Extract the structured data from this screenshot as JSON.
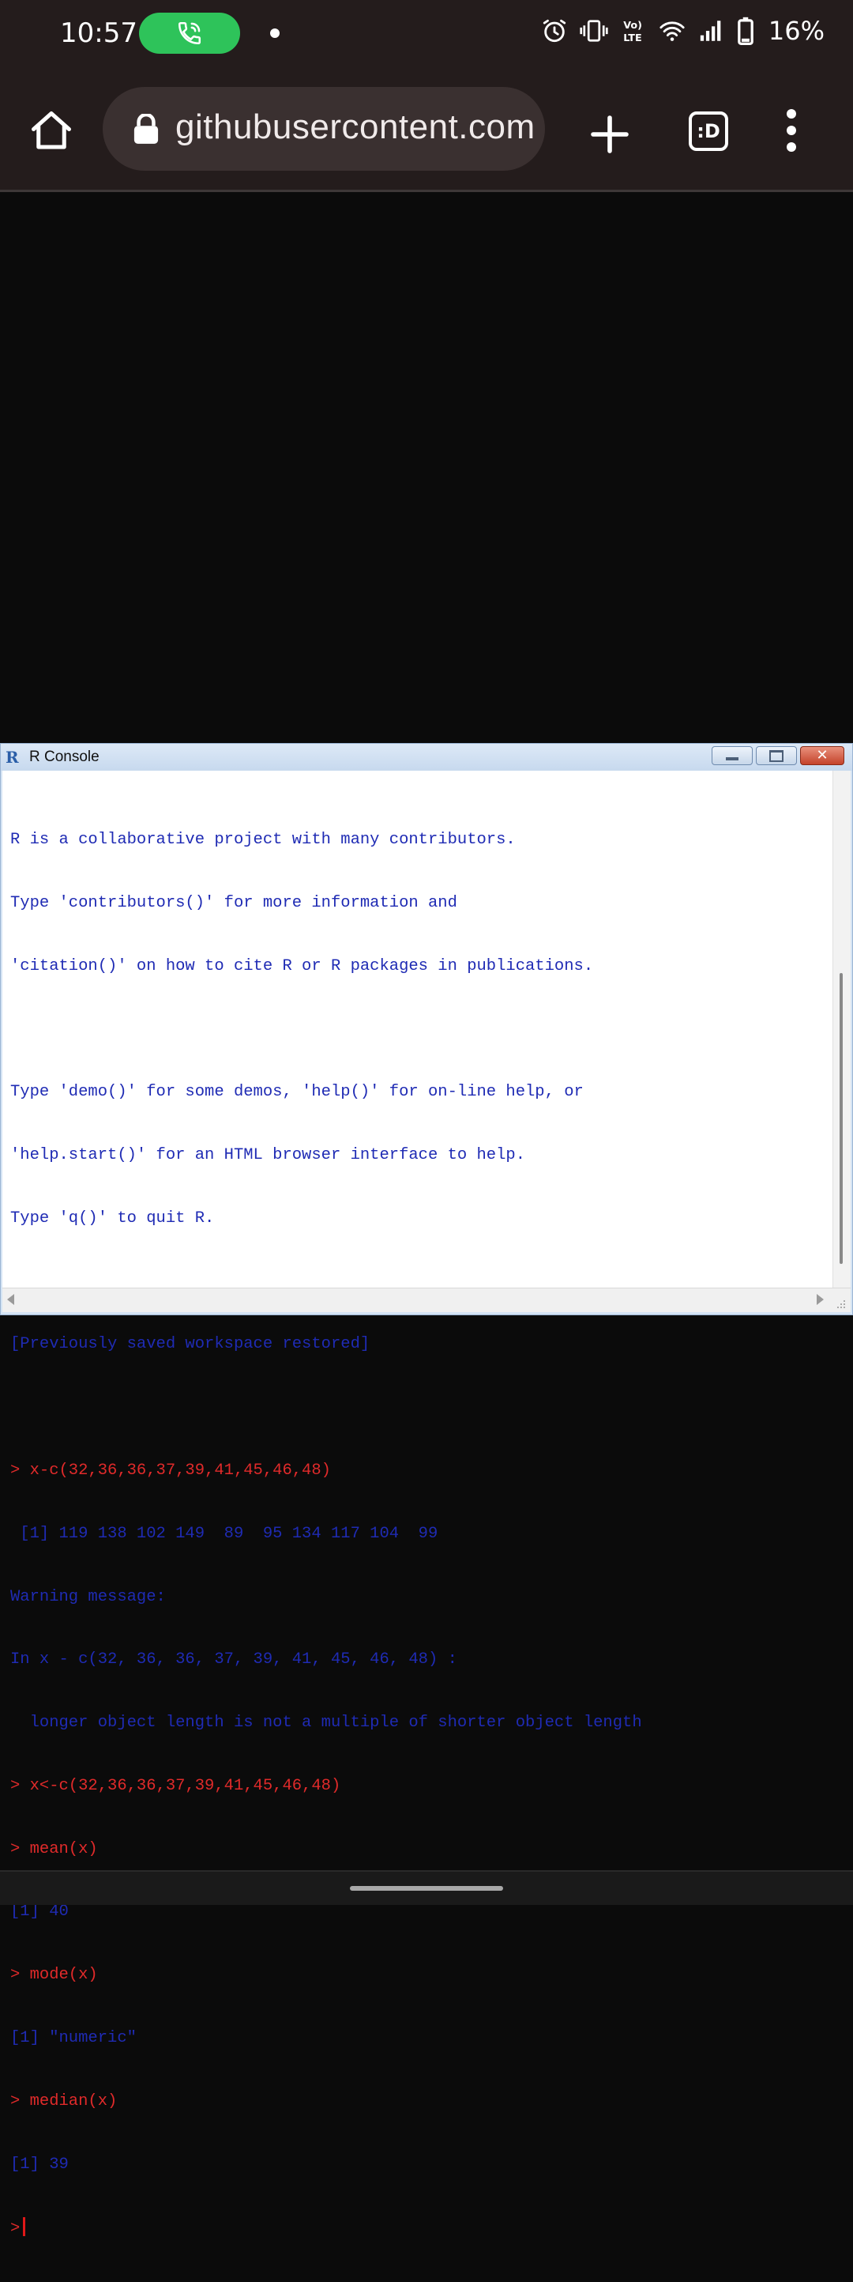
{
  "status_bar": {
    "time": "10:57",
    "battery": "16%",
    "icons": [
      "phone-call-icon",
      "notification-dot-icon",
      "alarm-icon",
      "vibrate-icon",
      "volte-icon",
      "wifi-icon",
      "signal-icon",
      "battery-icon"
    ]
  },
  "browser": {
    "url": "githubusercontent.com",
    "tab_count": ":D",
    "icons": [
      "home-icon",
      "lock-icon",
      "plus-icon",
      "menu-dots-icon"
    ]
  },
  "r_console": {
    "title": "R Console",
    "lines": [
      {
        "kind": "out",
        "text": "R is a collaborative project with many contributors."
      },
      {
        "kind": "out",
        "text": "Type 'contributors()' for more information and"
      },
      {
        "kind": "out",
        "text": "'citation()' on how to cite R or R packages in publications."
      },
      {
        "kind": "out",
        "text": ""
      },
      {
        "kind": "out",
        "text": "Type 'demo()' for some demos, 'help()' for on-line help, or"
      },
      {
        "kind": "out",
        "text": "'help.start()' for an HTML browser interface to help."
      },
      {
        "kind": "out",
        "text": "Type 'q()' to quit R."
      },
      {
        "kind": "out",
        "text": ""
      },
      {
        "kind": "out",
        "text": "[Previously saved workspace restored]"
      },
      {
        "kind": "out",
        "text": ""
      },
      {
        "kind": "cmd",
        "text": "> x-c(32,36,36,37,39,41,45,46,48)"
      },
      {
        "kind": "out",
        "text": " [1] 119 138 102 149  89  95 134 117 104  99"
      },
      {
        "kind": "out",
        "text": "Warning message:"
      },
      {
        "kind": "out",
        "text": "In x - c(32, 36, 36, 37, 39, 41, 45, 46, 48) :"
      },
      {
        "kind": "out",
        "text": "  longer object length is not a multiple of shorter object length"
      },
      {
        "kind": "cmd",
        "text": "> x<-c(32,36,36,37,39,41,45,46,48)"
      },
      {
        "kind": "cmd",
        "text": "> mean(x)"
      },
      {
        "kind": "out",
        "text": "[1] 40"
      },
      {
        "kind": "cmd",
        "text": "> mode(x)"
      },
      {
        "kind": "out",
        "text": "[1] \"numeric\""
      },
      {
        "kind": "cmd",
        "text": "> median(x)"
      },
      {
        "kind": "out",
        "text": "[1] 39"
      }
    ],
    "prompt": ">"
  },
  "colors": {
    "output_text": "#1f2bb4",
    "command_text": "#e02a2a",
    "call_pill": "#2ec35a",
    "chrome_bg": "#241c1c"
  }
}
